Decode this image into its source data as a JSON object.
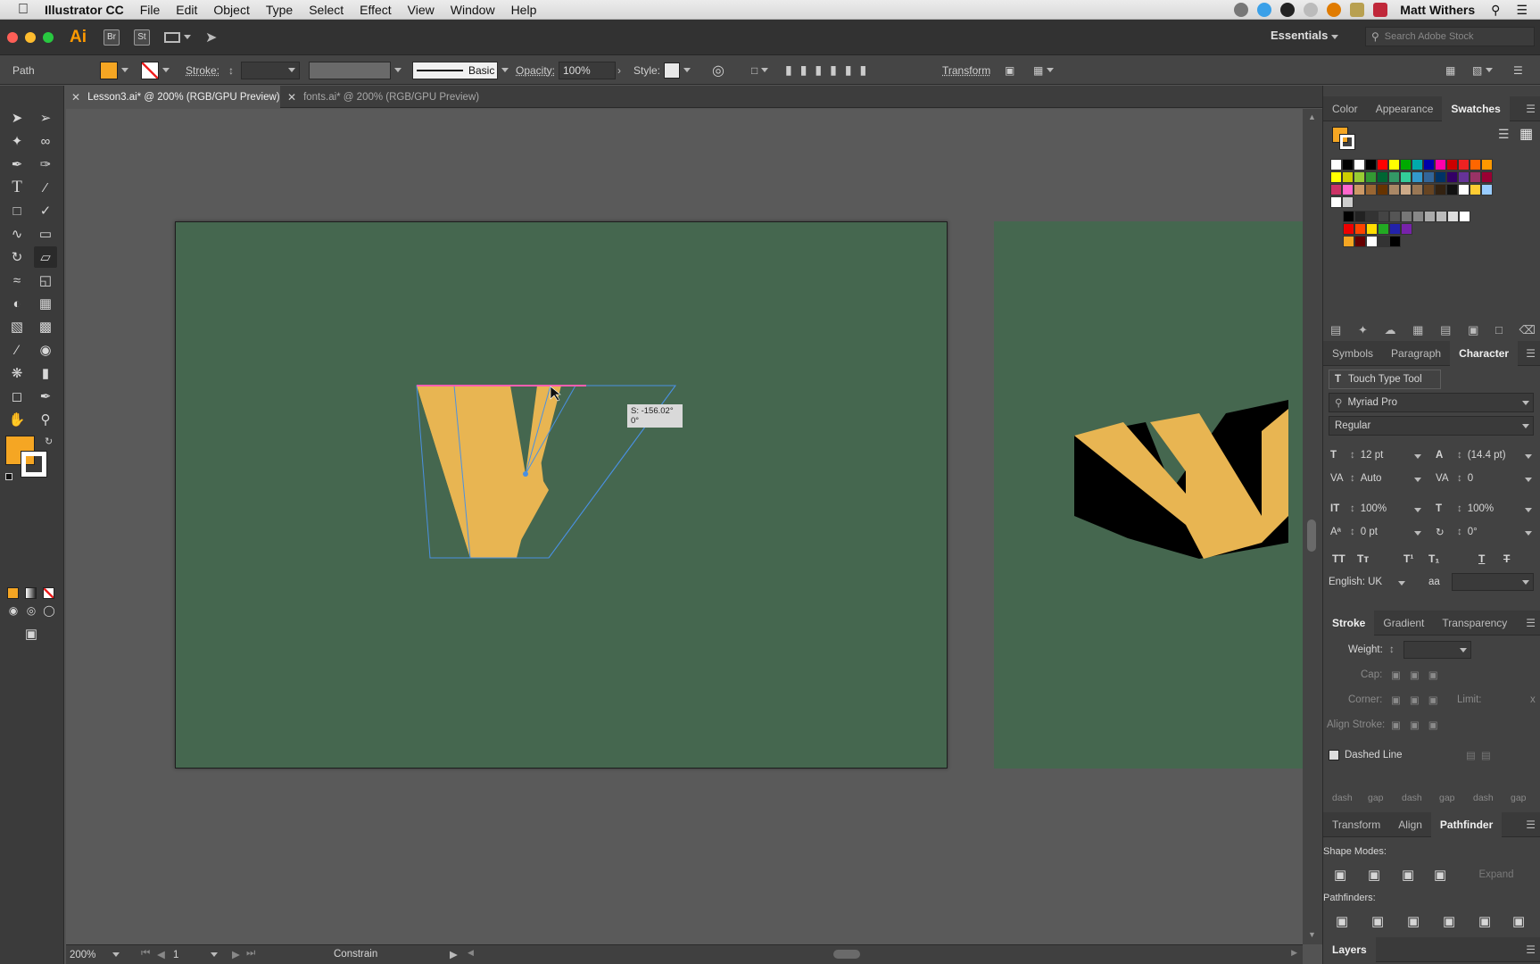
{
  "menubar": {
    "app_name": "Illustrator CC",
    "items": [
      "File",
      "Edit",
      "Object",
      "Type",
      "Select",
      "Effect",
      "View",
      "Window",
      "Help"
    ],
    "user_name": "Matt Withers"
  },
  "appbar": {
    "logo": "Ai",
    "bridge": "Br",
    "stock": "St",
    "workspace": "Essentials",
    "search_placeholder": "Search Adobe Stock"
  },
  "control_bar": {
    "selection_type": "Path",
    "fill_color": "#f5a623",
    "stroke_label": "Stroke:",
    "brush_label": "Basic",
    "opacity_label": "Opacity:",
    "opacity_value": "100%",
    "style_label": "Style:",
    "transform_label": "Transform"
  },
  "doc_tabs": [
    {
      "label": "Lesson3.ai* @ 200% (RGB/GPU Preview)",
      "active": true
    },
    {
      "label": "fonts.ai* @ 200% (RGB/GPU Preview)",
      "active": false
    }
  ],
  "canvas": {
    "artboard_color": "#45674f",
    "shape_fill": "#e8b552",
    "tooltip_line1": "S: -156.02°",
    "tooltip_line2": "0°"
  },
  "status_bar": {
    "zoom": "200%",
    "page": "1",
    "tool_status": "Constrain"
  },
  "swatches_panel": {
    "tabs": [
      "Color",
      "Appearance",
      "Swatches"
    ],
    "active_tab": "Swatches"
  },
  "character_panel": {
    "tabs": [
      "Symbols",
      "Paragraph",
      "Character"
    ],
    "active_tab": "Character",
    "touch_type_label": "Touch Type Tool",
    "font_family": "Myriad Pro",
    "font_style": "Regular",
    "font_size": "12 pt",
    "leading": "(14.4 pt)",
    "kerning": "Auto",
    "tracking": "0",
    "vertical_scale": "100%",
    "horizontal_scale": "100%",
    "baseline_shift": "0 pt",
    "rotation": "0°",
    "language": "English: UK"
  },
  "stroke_panel": {
    "tabs": [
      "Stroke",
      "Gradient",
      "Transparency"
    ],
    "active_tab": "Stroke",
    "weight_label": "Weight:",
    "cap_label": "Cap:",
    "corner_label": "Corner:",
    "limit_label": "Limit:",
    "limit_suffix": "x",
    "align_stroke_label": "Align Stroke:",
    "dashed_line_label": "Dashed Line",
    "dash_labels": [
      "dash",
      "gap",
      "dash",
      "gap",
      "dash",
      "gap"
    ]
  },
  "pathfinder_panel": {
    "tabs": [
      "Transform",
      "Align",
      "Pathfinder"
    ],
    "active_tab": "Pathfinder",
    "shape_modes_label": "Shape Modes:",
    "expand_label": "Expand",
    "pathfinders_label": "Pathfinders:"
  },
  "layers_panel": {
    "title": "Layers"
  }
}
